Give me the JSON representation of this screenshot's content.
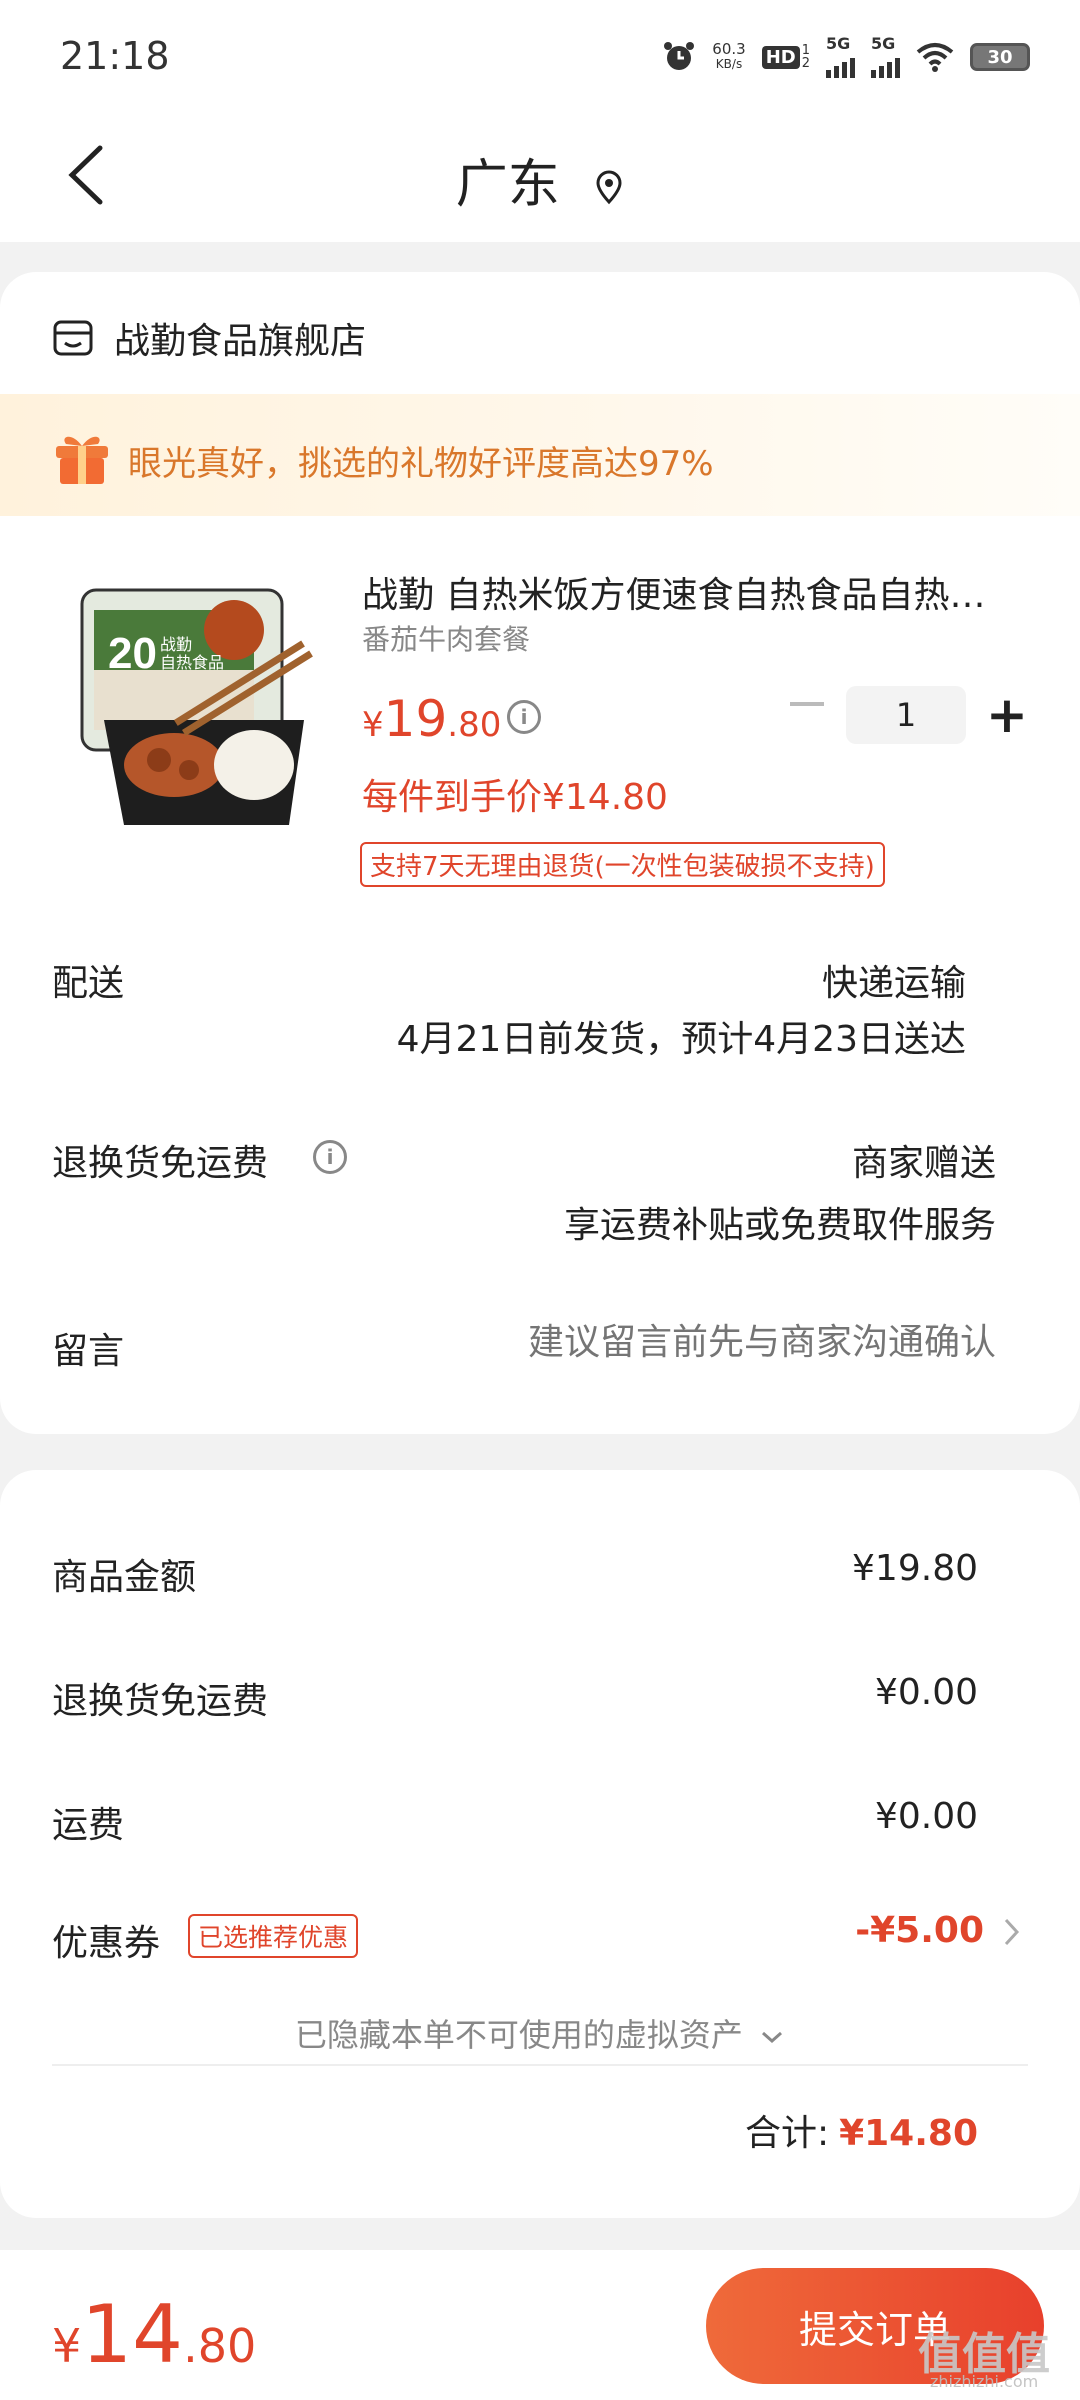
{
  "status_bar": {
    "time": "21:18",
    "net_speed_value": "60.3",
    "net_speed_unit": "KB/s",
    "hd_label": "HD",
    "hd_sub_1": "1",
    "hd_sub_2": "2",
    "sim1_label": "5G",
    "sim2_label": "5G",
    "battery": "30"
  },
  "nav": {
    "title": "广东"
  },
  "shop": {
    "name": "战勤食品旗舰店"
  },
  "banner": {
    "text": "眼光真好，挑选的礼物好评度高达97%"
  },
  "product": {
    "title": "战勤 自热米饭方便速食自热食品自热米饭",
    "variant": "番茄牛肉套餐",
    "price_currency": "¥",
    "price_int": "19",
    "price_dec": ".80",
    "each_price_text": "每件到手价¥14.80",
    "return_policy": "支持7天无理由退货(一次性包装破损不支持)",
    "quantity": "1",
    "image_text_big": "20",
    "image_text_brand": "战勤",
    "image_text_product": "自热食品"
  },
  "delivery": {
    "label": "配送",
    "method": "快递运输",
    "eta": "4月21日前发货，预计4月23日送达"
  },
  "return_shipping": {
    "label": "退换货免运费",
    "value": "商家赠送",
    "sub": "享运费补贴或免费取件服务"
  },
  "message": {
    "label": "留言",
    "placeholder": "建议留言前先与商家沟通确认"
  },
  "summary": {
    "goods_label": "商品金额",
    "goods_value": "¥19.80",
    "return_label": "退换货免运费",
    "return_value": "¥0.00",
    "shipping_label": "运费",
    "shipping_value": "¥0.00",
    "coupon_label": "优惠券",
    "coupon_tag": "已选推荐优惠",
    "coupon_value": "-¥5.00",
    "hidden_assets": "已隐藏本单不可使用的虚拟资产",
    "total_label": "合计:",
    "total_value": "¥14.80"
  },
  "bottom": {
    "price_currency": "¥",
    "price_int": "14",
    "price_dec": ".80",
    "submit_label": "提交订单",
    "watermark": "值值值",
    "watermark_sub": "zhizhizhi.com"
  },
  "colors": {
    "accent_red": "#e0452b",
    "banner_orange": "#d9772b",
    "submit_gradient_start": "#ef6a3a",
    "submit_gradient_end": "#e8402c"
  }
}
